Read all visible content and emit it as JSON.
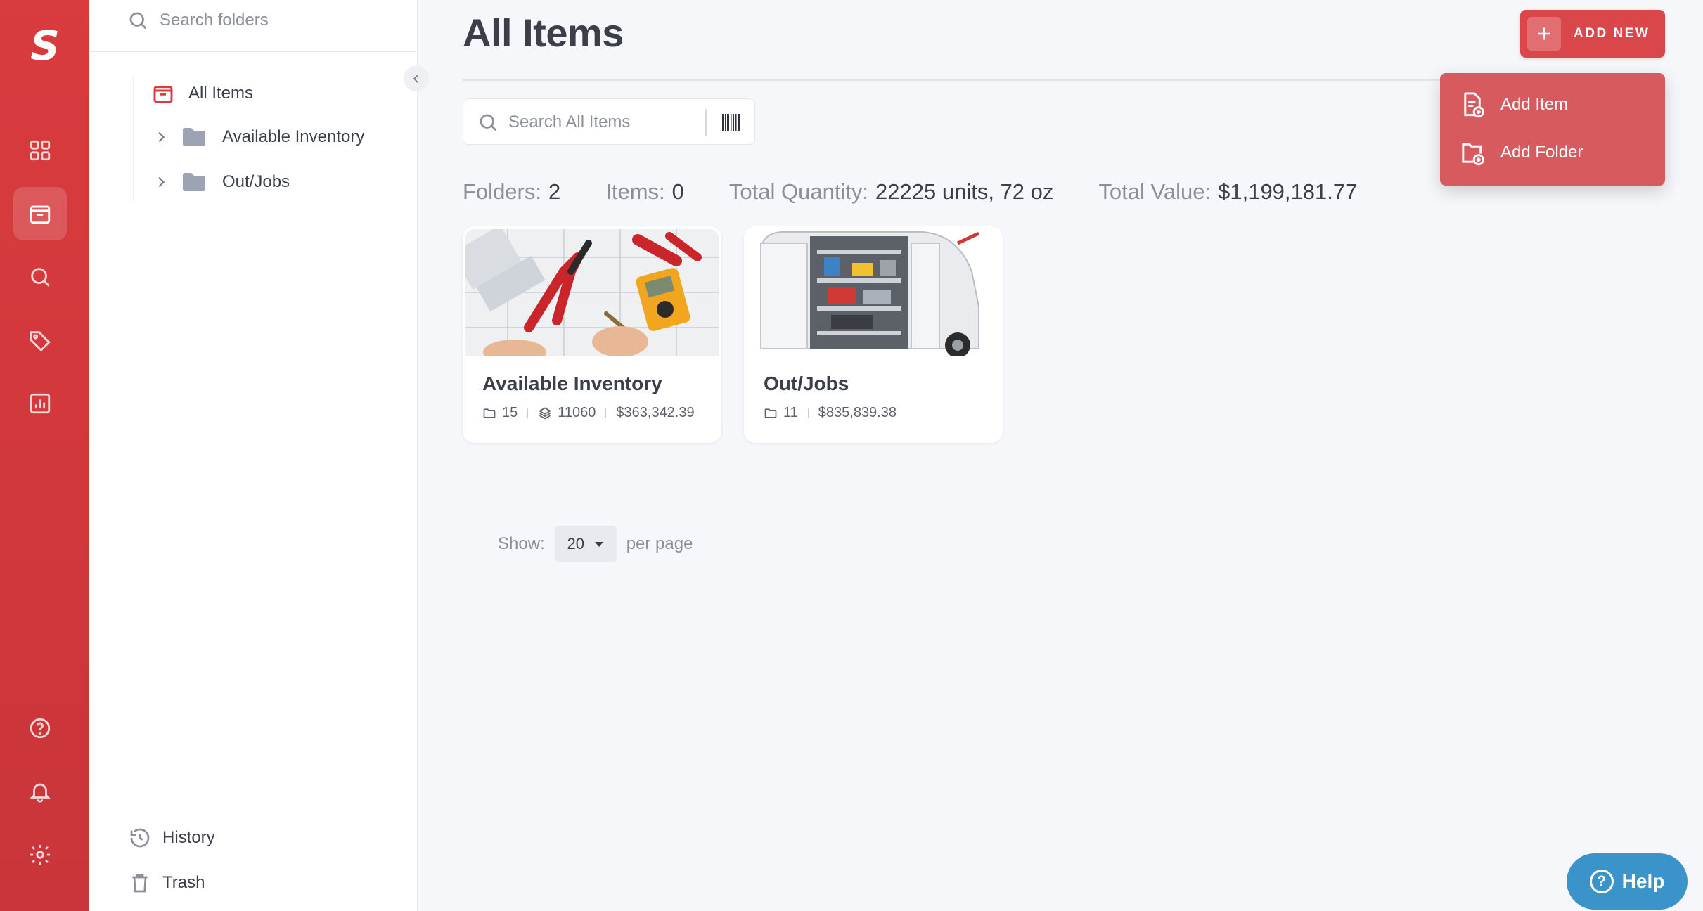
{
  "app": {
    "logo_letter": "S"
  },
  "rail": {
    "icons": [
      "dashboard-icon",
      "items-icon",
      "search-icon",
      "tags-icon",
      "reports-icon",
      "help-circle-icon",
      "bell-icon",
      "gear-icon"
    ],
    "active": "items-icon"
  },
  "folders_panel": {
    "search_placeholder": "Search folders",
    "all_items_label": "All Items",
    "tree": [
      {
        "label": "Available Inventory"
      },
      {
        "label": "Out/Jobs"
      }
    ],
    "history_label": "History",
    "trash_label": "Trash"
  },
  "main": {
    "title": "All Items",
    "add_new_label": "ADD NEW",
    "add_menu": [
      {
        "label": "Add Item",
        "icon": "add-item-icon"
      },
      {
        "label": "Add Folder",
        "icon": "add-folder-icon"
      }
    ],
    "search_placeholder": "Search All Items",
    "stats": {
      "folders_label": "Folders:",
      "folders_value": "2",
      "items_label": "Items:",
      "items_value": "0",
      "quantity_label": "Total Quantity:",
      "quantity_value": "22225 units, 72 oz",
      "value_label": "Total Value:",
      "value_value": "$1,199,181.77"
    },
    "cards": [
      {
        "name": "Available Inventory",
        "folders": "15",
        "quantity": "11060",
        "value": "$363,342.39",
        "image": "tools-photo"
      },
      {
        "name": "Out/Jobs",
        "folders": "11",
        "value": "$835,839.38",
        "image": "van-photo"
      }
    ],
    "pager": {
      "show_label": "Show:",
      "per_page_value": "20",
      "per_page_label": "per page"
    }
  },
  "help_label": "Help",
  "colors": {
    "brand_red": "#d93b3e",
    "menu_red": "#d65a5e",
    "help_blue": "#3a93c9"
  }
}
